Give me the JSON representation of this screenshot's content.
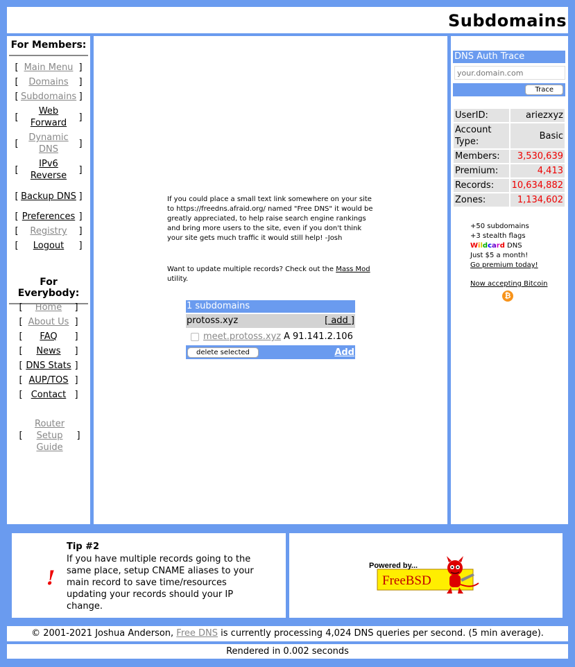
{
  "header": {
    "title": "Subdomains"
  },
  "members": {
    "heading": "For Members:",
    "items": [
      {
        "label": "Main Menu"
      },
      {
        "label": "Domains"
      },
      {
        "label": "Subdomains"
      },
      {
        "label": "Web Forward"
      },
      {
        "label": "Dynamic DNS"
      },
      {
        "label": "IPv6 Reverse"
      },
      {
        "label": "Backup DNS"
      },
      {
        "label": "Preferences"
      },
      {
        "label": "Registry"
      },
      {
        "label": "Logout"
      }
    ]
  },
  "everybody": {
    "heading": "For Everybody:",
    "items": [
      {
        "label": "Home"
      },
      {
        "label": "About Us"
      },
      {
        "label": "FAQ"
      },
      {
        "label": "News"
      },
      {
        "label": "DNS Stats"
      },
      {
        "label": "AUP/TOS"
      },
      {
        "label": "Contact"
      },
      {
        "label": "Router Setup Guide"
      }
    ]
  },
  "brackets": {
    "open": "[",
    "close": "]"
  },
  "main": {
    "promo": "If you could place a small text link somewhere on your site to https://freedns.afraid.org/ named \"Free DNS\" it would be greatly appreciated, to help raise search engine rankings and bring more users to the site, even if you don't think your site gets much traffic it would still help! -Josh",
    "massmod_prefix": "Want to update multiple records? Check out the ",
    "massmod_link": "Mass Mod",
    "massmod_suffix": " utility.",
    "table": {
      "heading": "1 subdomains",
      "domain": "protoss.xyz",
      "add_label": "[ add ]",
      "rows": [
        {
          "host": "meet.protoss.xyz",
          "type": "A",
          "value": "91.141.2.106"
        }
      ],
      "delete_button": "delete selected",
      "add_link": "Add"
    }
  },
  "trace": {
    "heading": "DNS Auth Trace",
    "placeholder": "your.domain.com",
    "button": "Trace"
  },
  "stats": [
    {
      "label": "UserID:",
      "value": "ariezxyz"
    },
    {
      "label": "Account Type:",
      "value": "Basic"
    },
    {
      "label": "Members:",
      "value": "3,530,639"
    },
    {
      "label": "Premium:",
      "value": "4,413"
    },
    {
      "label": "Records:",
      "value": "10,634,882"
    },
    {
      "label": "Zones:",
      "value": "1,134,602"
    }
  ],
  "premium": {
    "line1": "+50 subdomains",
    "line2": "+3 stealth flags",
    "wildcard": "Wildcard",
    "wildcard_suffix": " DNS",
    "line4": "Just $5 a month!",
    "cta": "Go premium today!",
    "bitcoin": "Now accepting Bitcoin",
    "bitcoin_symbol": "₿"
  },
  "tip": {
    "mark": "!",
    "title": "Tip #2",
    "text": "If you have multiple records going to the same place, setup CNAME aliases to your main record to save time/resources updating your records should your IP change."
  },
  "freebsd": {
    "powered": "Powered by...",
    "name": "FreeBSD"
  },
  "footer": {
    "copyright_prefix": "© 2001-2021 Joshua Anderson, ",
    "copyright_link": "Free DNS",
    "copyright_suffix": " is currently processing 4,024 DNS queries per second. (5 min average).",
    "rendered": "Rendered in 0.002 seconds"
  },
  "colors": {
    "frame": "#6a9bef",
    "stat_red": "#e00000",
    "panel_grey": "#e3e3e3"
  }
}
